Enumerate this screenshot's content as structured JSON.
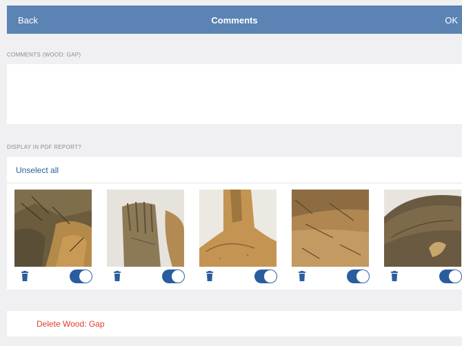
{
  "navbar": {
    "back_label": "Back",
    "title": "Comments",
    "ok_label": "OK"
  },
  "comments": {
    "header": "COMMENTS (WOOD: GAP)",
    "value": ""
  },
  "pdf": {
    "header": "DISPLAY IN PDF REPORT?",
    "unselect_label": "Unselect all"
  },
  "photos": [
    {
      "name": "photo-1",
      "included": true
    },
    {
      "name": "photo-2",
      "included": true
    },
    {
      "name": "photo-3",
      "included": true
    },
    {
      "name": "photo-4",
      "included": true
    },
    {
      "name": "photo-5",
      "included": true
    }
  ],
  "delete_label": "Delete Wood: Gap",
  "colors": {
    "nav_bar": "#5b83b4",
    "link": "#2a5d9f",
    "delete": "#e33b2e",
    "toggle_on": "#2a5d9f",
    "background": "#f0f0f3"
  },
  "icons": {
    "trash": "trash-icon"
  }
}
